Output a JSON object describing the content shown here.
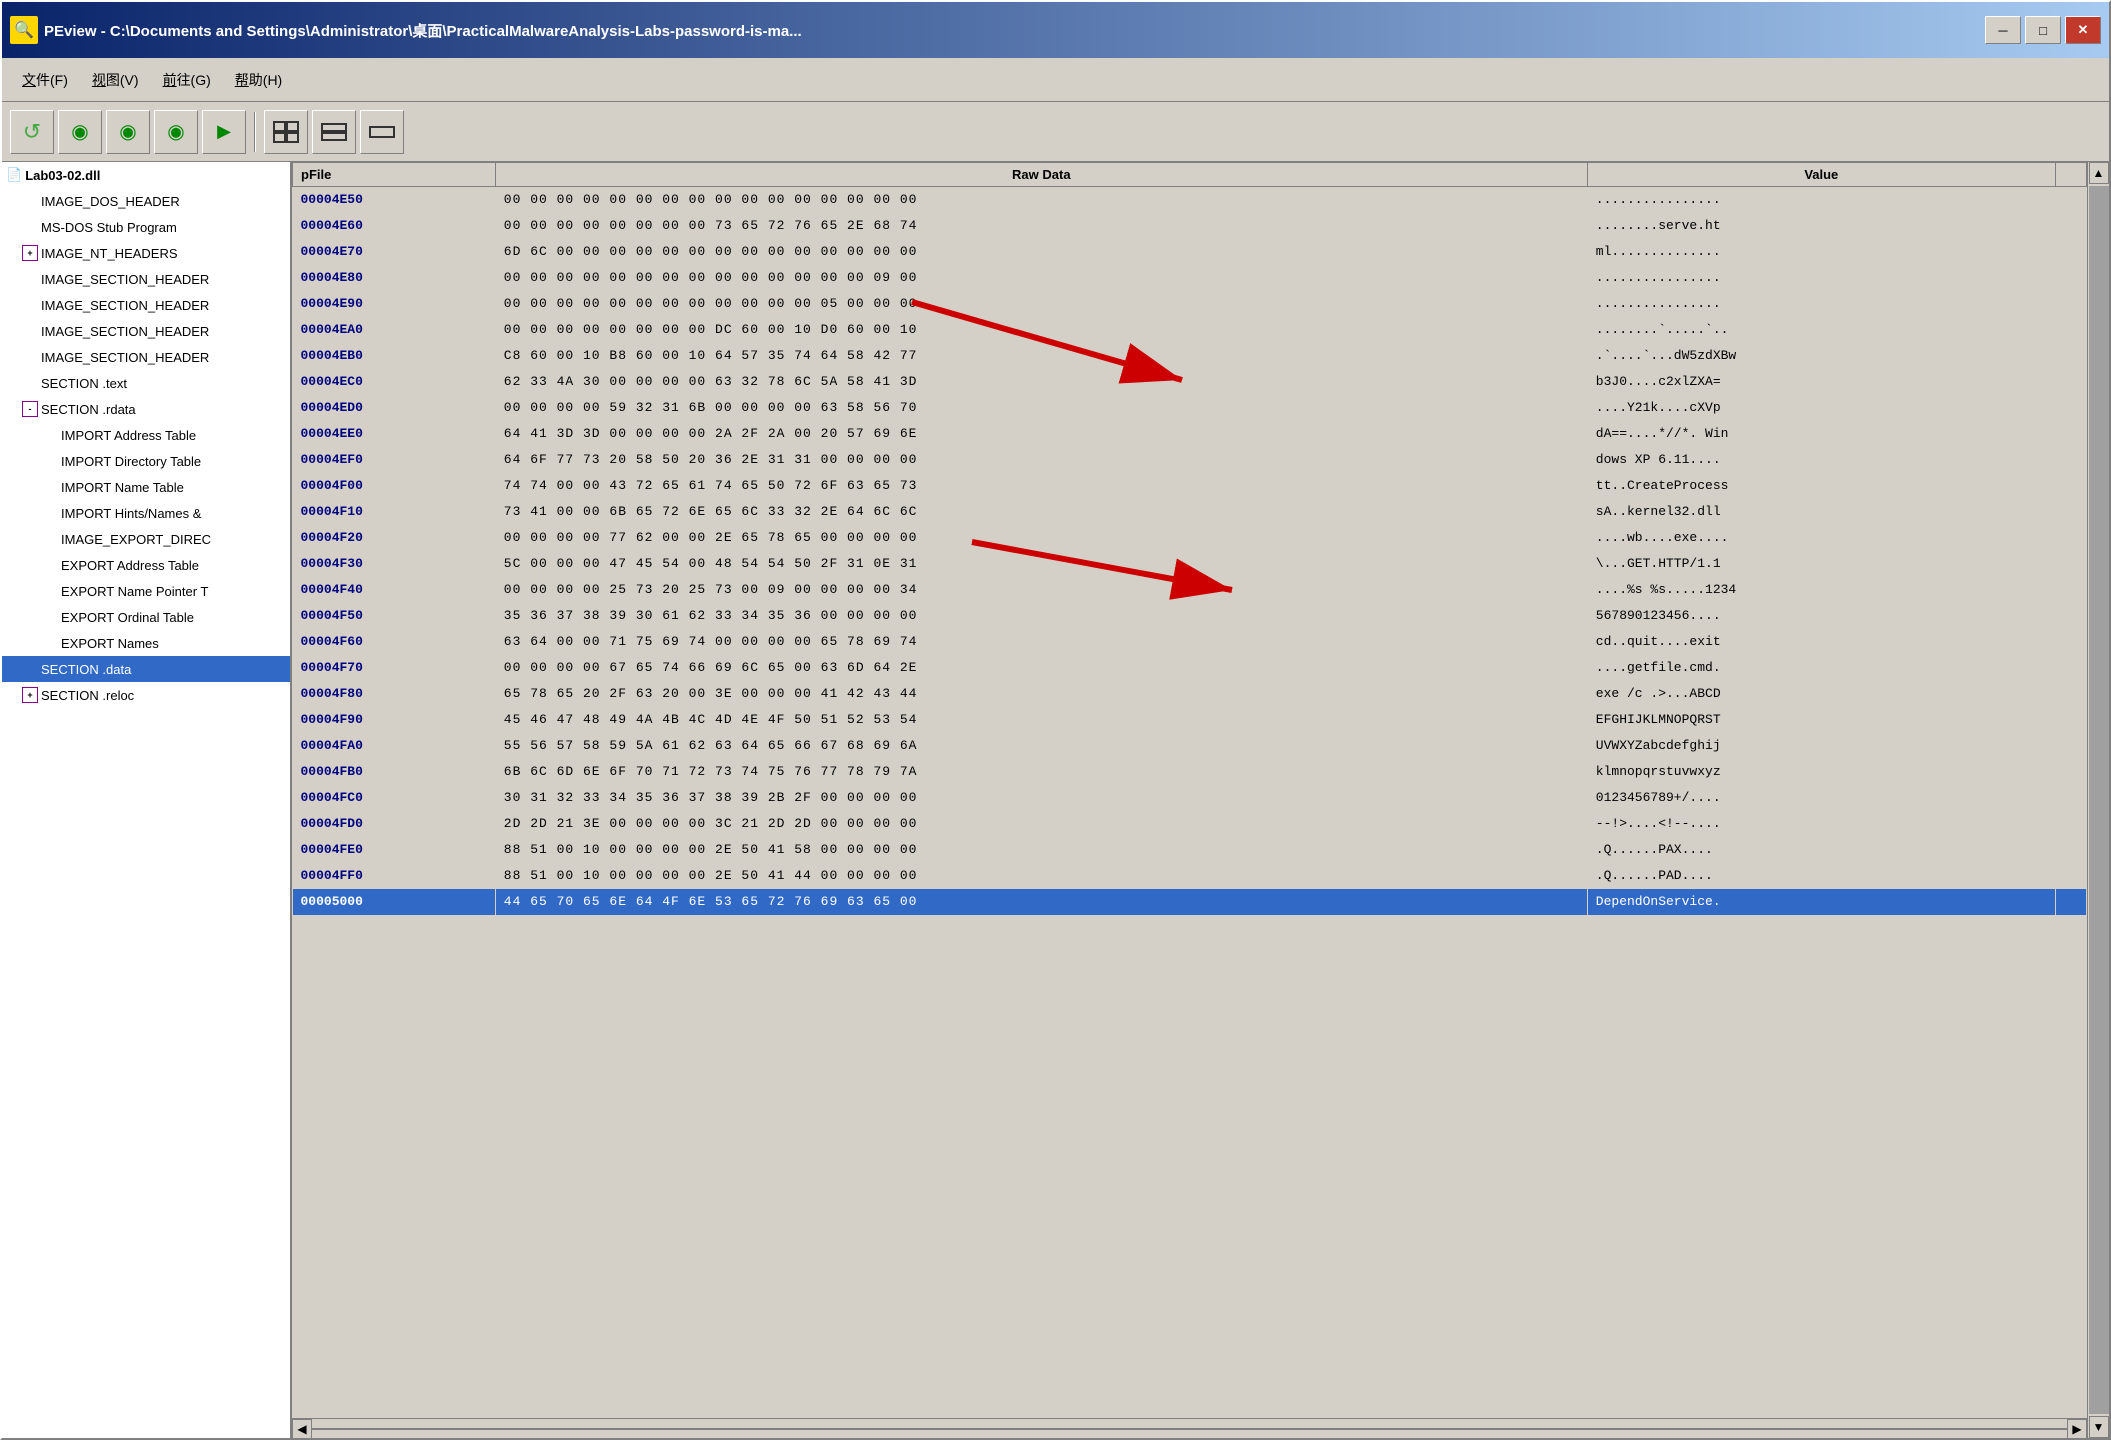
{
  "window": {
    "title": "PEview - C:\\Documents and Settings\\Administrator\\桌面\\PracticalMalwareAnalysis-Labs-password-is-ma...",
    "icon": "🔍"
  },
  "titlebar": {
    "minimize_label": "─",
    "maximize_label": "□",
    "close_label": "✕"
  },
  "menu": {
    "items": [
      {
        "label": "文件(F)",
        "key": "file"
      },
      {
        "label": "视图(V)",
        "key": "view"
      },
      {
        "label": "前往(G)",
        "key": "goto"
      },
      {
        "label": "帮助(H)",
        "key": "help"
      }
    ]
  },
  "toolbar": {
    "buttons": [
      {
        "icon": "↺",
        "name": "refresh"
      },
      {
        "icon": "◀",
        "name": "back"
      },
      {
        "icon": "▶",
        "name": "forward-green"
      },
      {
        "icon": "▶",
        "name": "forward-light"
      },
      {
        "icon": "▶▶",
        "name": "fast-forward"
      }
    ],
    "buttons2": [
      {
        "icon": "⬛",
        "name": "view1"
      },
      {
        "icon": "▬",
        "name": "view2"
      },
      {
        "icon": "─",
        "name": "view3"
      }
    ]
  },
  "left_panel": {
    "root": "Lab03-02.dll",
    "items": [
      {
        "label": "IMAGE_DOS_HEADER",
        "indent": 1,
        "expand": null
      },
      {
        "label": "MS-DOS Stub Program",
        "indent": 1,
        "expand": null
      },
      {
        "label": "IMAGE_NT_HEADERS",
        "indent": 1,
        "expand": "plus"
      },
      {
        "label": "IMAGE_SECTION_HEADER",
        "indent": 1,
        "expand": null
      },
      {
        "label": "IMAGE_SECTION_HEADER",
        "indent": 1,
        "expand": null
      },
      {
        "label": "IMAGE_SECTION_HEADER",
        "indent": 1,
        "expand": null
      },
      {
        "label": "IMAGE_SECTION_HEADER",
        "indent": 1,
        "expand": null
      },
      {
        "label": "SECTION .text",
        "indent": 1,
        "expand": null
      },
      {
        "label": "SECTION .rdata",
        "indent": 1,
        "expand": "minus"
      },
      {
        "label": "IMPORT Address Table",
        "indent": 2,
        "expand": null
      },
      {
        "label": "IMPORT Directory Table",
        "indent": 2,
        "expand": null
      },
      {
        "label": "IMPORT Name Table",
        "indent": 2,
        "expand": null
      },
      {
        "label": "IMPORT Hints/Names &",
        "indent": 2,
        "expand": null
      },
      {
        "label": "IMAGE_EXPORT_DIREC",
        "indent": 2,
        "expand": null
      },
      {
        "label": "EXPORT Address Table",
        "indent": 2,
        "expand": null
      },
      {
        "label": "EXPORT Name Pointer T",
        "indent": 2,
        "expand": null
      },
      {
        "label": "EXPORT Ordinal Table",
        "indent": 2,
        "expand": null
      },
      {
        "label": "EXPORT Names",
        "indent": 2,
        "expand": null
      },
      {
        "label": "SECTION .data",
        "indent": 1,
        "expand": null,
        "selected": true
      },
      {
        "label": "SECTION .reloc",
        "indent": 1,
        "expand": "plus"
      }
    ]
  },
  "table": {
    "headers": [
      "pFile",
      "Raw Data",
      "Value"
    ],
    "rows": [
      {
        "addr": "00004E50",
        "hex1": "00 00 00 00 00 00 00 00",
        "hex2": "00 00 00 00 00 00 00 00",
        "value": "................"
      },
      {
        "addr": "00004E60",
        "hex1": "00 00 00 00 00 00 00 00",
        "hex2": "73 65 72 76 65 2E 68 74",
        "value": "........serve.ht"
      },
      {
        "addr": "00004E70",
        "hex1": "6D 6C 00 00 00 00 00 00",
        "hex2": "00 00 00 00 00 00 00 00",
        "value": "ml.............."
      },
      {
        "addr": "00004E80",
        "hex1": "00 00 00 00 00 00 00 00",
        "hex2": "00 00 00 00 00 00 09 00",
        "value": "................"
      },
      {
        "addr": "00004E90",
        "hex1": "00 00 00 00 00 00 00 00",
        "hex2": "00 00 00 00 05 00 00 00",
        "value": "................"
      },
      {
        "addr": "00004EA0",
        "hex1": "00 00 00 00 00 00 00 00",
        "hex2": "DC 60 00 10 D0 60 00 10",
        "value": "........`.....`.."
      },
      {
        "addr": "00004EB0",
        "hex1": "C8 60 00 10 B8 60 00 10",
        "hex2": "64 57 35 74 64 58 42 77",
        "value": ".`....`...dW5zdXBw"
      },
      {
        "addr": "00004EC0",
        "hex1": "62 33 4A 30 00 00 00 00",
        "hex2": "63 32 78 6C 5A 58 41 3D",
        "value": "b3J0....c2xlZXA="
      },
      {
        "addr": "00004ED0",
        "hex1": "00 00 00 00 59 32 31 6B",
        "hex2": "00 00 00 00 63 58 56 70",
        "value": "....Y21k....cXVp"
      },
      {
        "addr": "00004EE0",
        "hex1": "64 41 3D 3D 00 00 00 00",
        "hex2": "2A 2F 2A 00 20 57 69 6E",
        "value": "dA==....*//*. Win"
      },
      {
        "addr": "00004EF0",
        "hex1": "64 6F 77 73 20 58 50 20",
        "hex2": "36 2E 31 31 00 00 00 00",
        "value": "dows XP 6.11...."
      },
      {
        "addr": "00004F00",
        "hex1": "74 74 00 00 43 72 65 61",
        "hex2": "74 65 50 72 6F 63 65 73",
        "value": "tt..CreateProcess"
      },
      {
        "addr": "00004F10",
        "hex1": "73 41 00 00 6B 65 72 6E",
        "hex2": "65 6C 33 32 2E 64 6C 6C",
        "value": "sA..kernel32.dll"
      },
      {
        "addr": "00004F20",
        "hex1": "00 00 00 00 77 62 00 00",
        "hex2": "2E 65 78 65 00 00 00 00",
        "value": "....wb....exe...."
      },
      {
        "addr": "00004F30",
        "hex1": "5C 00 00 00 47 45 54 00",
        "hex2": "48 54 54 50 2F 31 0E 31",
        "value": "\\...GET.HTTP/1.1"
      },
      {
        "addr": "00004F40",
        "hex1": "00 00 00 00 25 73 20 25",
        "hex2": "73 00 09 00 00 00 00 34",
        "value": "....%s %s.....1234"
      },
      {
        "addr": "00004F50",
        "hex1": "35 36 37 38 39 30 61 62",
        "hex2": "33 34 35 36 00 00 00 00",
        "value": "567890123456...."
      },
      {
        "addr": "00004F60",
        "hex1": "63 64 00 00 71 75 69 74",
        "hex2": "00 00 00 00 65 78 69 74",
        "value": "cd..quit....exit"
      },
      {
        "addr": "00004F70",
        "hex1": "00 00 00 00 67 65 74 66",
        "hex2": "69 6C 65 00 63 6D 64 2E",
        "value": "....getfile.cmd."
      },
      {
        "addr": "00004F80",
        "hex1": "65 78 65 20 2F 63 20 00",
        "hex2": "3E 00 00 00 41 42 43 44",
        "value": "exe /c .>...ABCD"
      },
      {
        "addr": "00004F90",
        "hex1": "45 46 47 48 49 4A 4B 4C",
        "hex2": "4D 4E 4F 50 51 52 53 54",
        "value": "EFGHIJKLMNOPQRST"
      },
      {
        "addr": "00004FA0",
        "hex1": "55 56 57 58 59 5A 61 62",
        "hex2": "63 64 65 66 67 68 69 6A",
        "value": "UVWXYZabcdefghij"
      },
      {
        "addr": "00004FB0",
        "hex1": "6B 6C 6D 6E 6F 70 71 72",
        "hex2": "73 74 75 76 77 78 79 7A",
        "value": "klmnopqrstuvwxyz"
      },
      {
        "addr": "00004FC0",
        "hex1": "30 31 32 33 34 35 36 37",
        "hex2": "38 39 2B 2F 00 00 00 00",
        "value": "0123456789+/...."
      },
      {
        "addr": "00004FD0",
        "hex1": "2D 2D 21 3E 00 00 00 00",
        "hex2": "3C 21 2D 2D 00 00 00 00",
        "value": "--!>....<!--...."
      },
      {
        "addr": "00004FE0",
        "hex1": "88 51 00 10 00 00 00 00",
        "hex2": "2E 50 41 58 00 00 00 00",
        "value": ".Q......PAX...."
      },
      {
        "addr": "00004FF0",
        "hex1": "88 51 00 10 00 00 00 00",
        "hex2": "2E 50 41 44 00 00 00 00",
        "value": ".Q......PAD...."
      },
      {
        "addr": "00005000",
        "hex1": "44 65 70 65 6E 64 4F 6E",
        "hex2": "53 65 72 76 69 63 65 00",
        "value": "DependOnService.",
        "selected": true
      }
    ]
  },
  "status": {
    "scroll_indicator": "▲"
  }
}
